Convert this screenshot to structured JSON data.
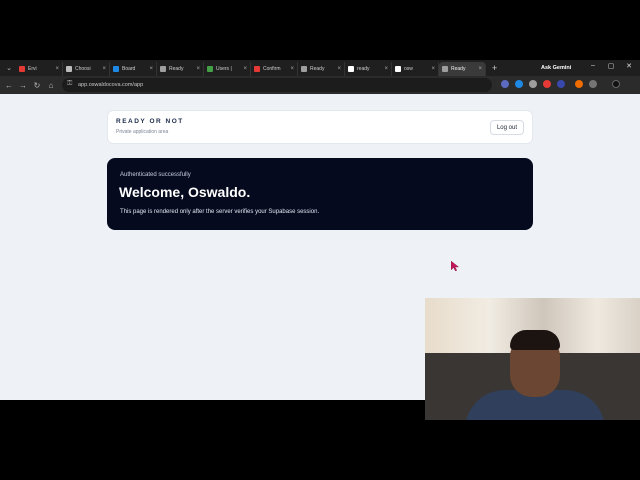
{
  "browser": {
    "tabs": [
      {
        "label": "Ervi",
        "color": "#e53935",
        "active": false
      },
      {
        "label": "Choosi",
        "color": "#bdbdbd",
        "active": false
      },
      {
        "label": "Board",
        "color": "#1e88e5",
        "active": false
      },
      {
        "label": "Ready",
        "color": "#9e9e9e",
        "active": false
      },
      {
        "label": "Users |",
        "color": "#43a047",
        "active": false
      },
      {
        "label": "Confirm",
        "color": "#e53935",
        "active": false
      },
      {
        "label": "Ready",
        "color": "#9e9e9e",
        "active": false
      },
      {
        "label": "ready",
        "color": "#ffffff",
        "active": false
      },
      {
        "label": "osw",
        "color": "#ffffff",
        "active": false
      },
      {
        "label": "Ready",
        "color": "#9e9e9e",
        "active": true
      }
    ],
    "new_tab": "+",
    "ask_gemini": "Ask Gemini",
    "window_controls": {
      "minimize": "–",
      "maximize": "▢",
      "close": "✕"
    },
    "nav": {
      "back": "←",
      "forward": "→",
      "reload": "↻",
      "home": "⌂"
    },
    "url": "app.oswaldocova.com/app"
  },
  "page": {
    "brand": "READY OR NOT",
    "subtitle": "Private application area",
    "logout_label": "Log out",
    "status": "Authenticated successfully",
    "welcome": "Welcome, Oswaldo.",
    "description": "This page is rendered only after the server verifies your Supabase session."
  },
  "colors": {
    "page_bg": "#eef1f6",
    "hero_bg": "#050a1f",
    "brand_text": "#1c2b4a",
    "cursor": "#c2185b"
  },
  "icons": {
    "cursor": "mouse-pointer-icon",
    "lock": "lock-icon"
  }
}
